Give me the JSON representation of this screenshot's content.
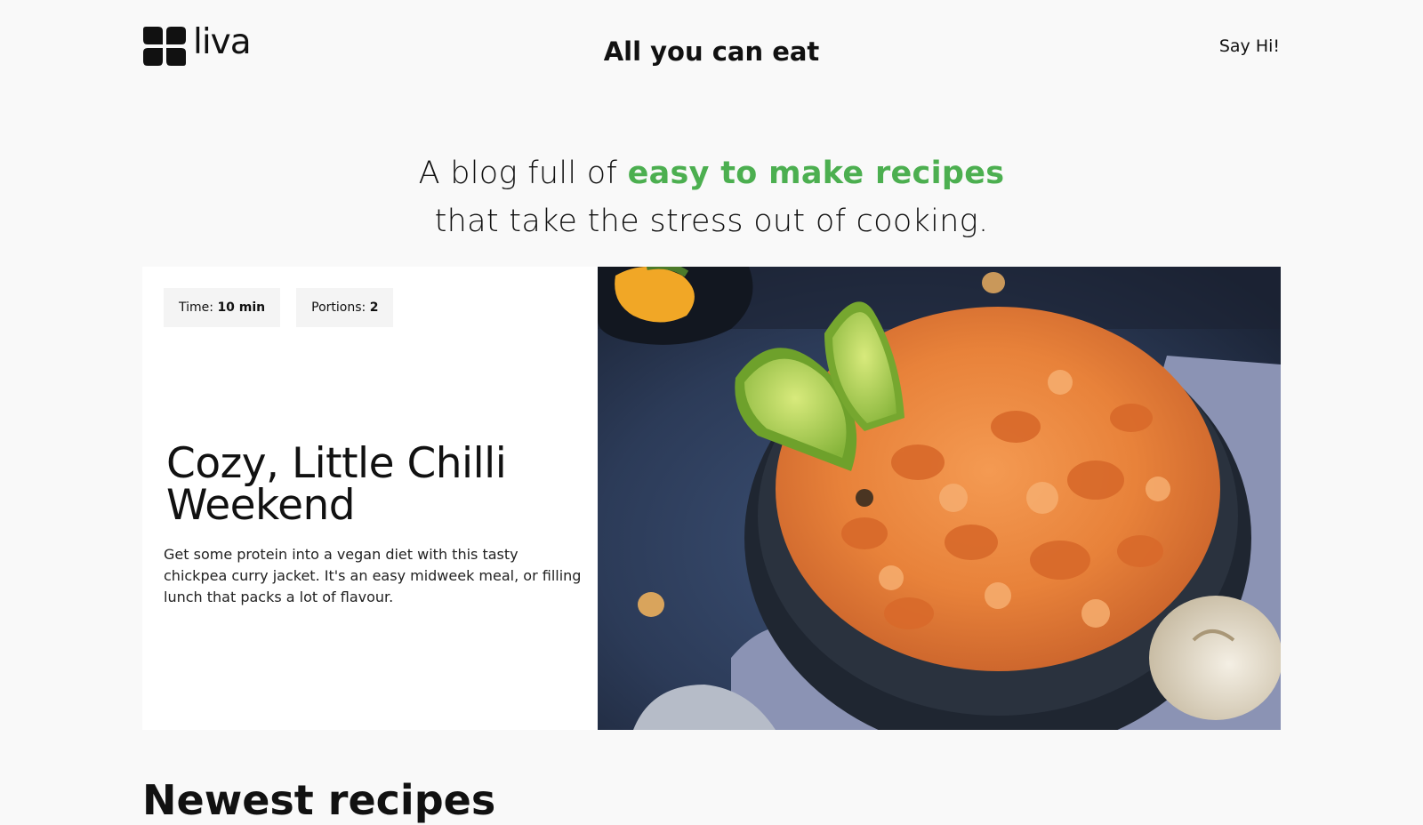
{
  "header": {
    "logo_text": "liva",
    "site_title": "All you can eat",
    "say_hi_label": "Say Hi!"
  },
  "hero": {
    "line1_prefix": "A blog full of ",
    "line1_accent": "easy to make recipes",
    "line2": "that take the stress out of cooking."
  },
  "featured": {
    "time_label": "Time:",
    "time_value": "10 min",
    "portions_label": "Portions:",
    "portions_value": "2",
    "title_line1": "Cozy, Little Chilli",
    "title_line2": "Weekend",
    "description": "Get some protein into a vegan diet with this tasty chickpea curry jacket. It's an easy midweek meal, or filling lunch that packs a lot of flavour."
  },
  "section": {
    "title": "Newest recipes"
  },
  "colors": {
    "accent": "#4caf50",
    "background": "#f9f9f9",
    "card": "#ffffff",
    "pill": "#f4f4f4"
  },
  "icons": {
    "logo": "clover-logo-icon"
  }
}
